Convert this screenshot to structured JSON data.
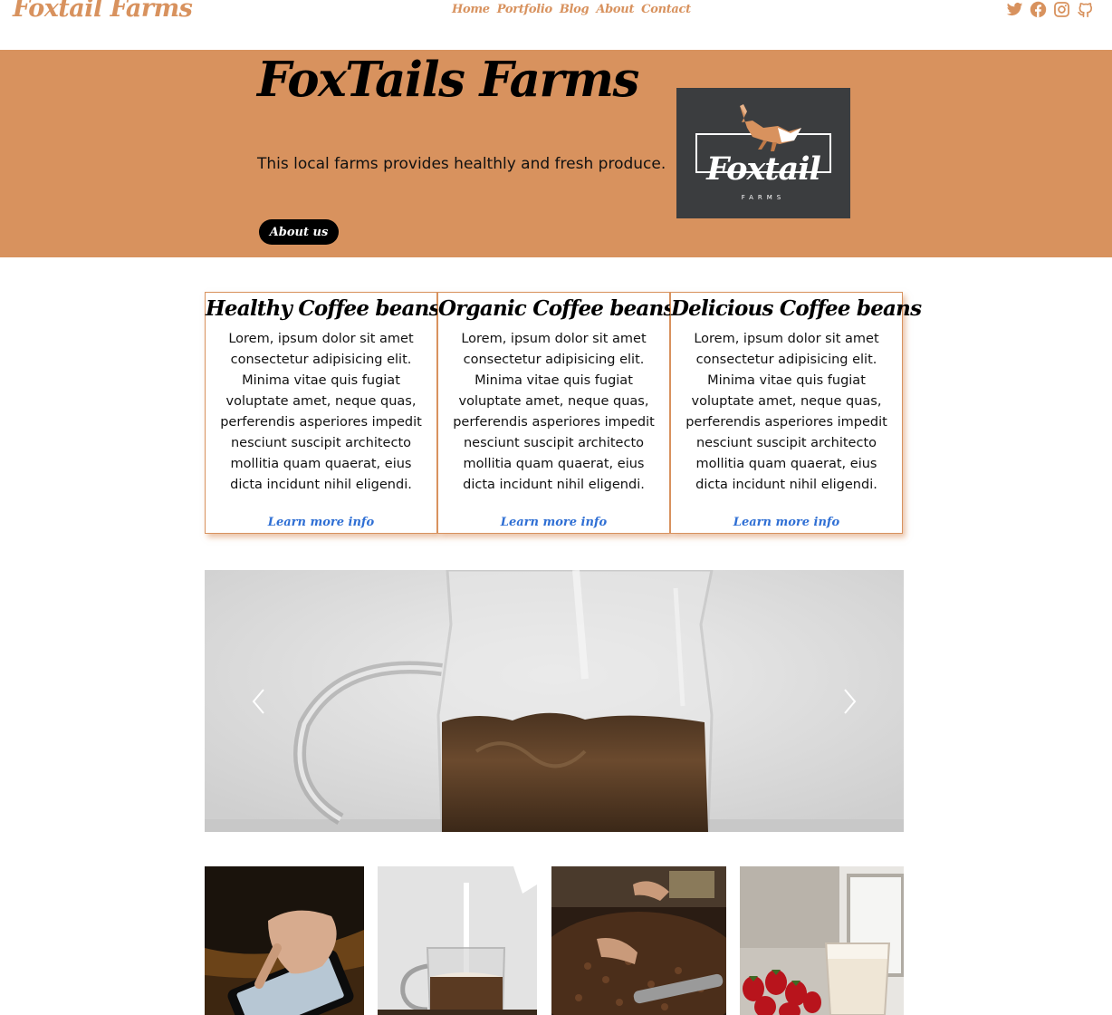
{
  "nav": {
    "brand": "Foxtail Farms",
    "links": [
      "Home",
      "Portfolio",
      "Blog",
      "About",
      "Contact"
    ],
    "social_icons": [
      "twitter-icon",
      "facebook-icon",
      "instagram-icon",
      "github-icon"
    ]
  },
  "hero": {
    "title": "FoxTails Farms",
    "tagline": "This local farms provides healthly and fresh produce.",
    "button_label": "About us",
    "logo": {
      "word": "Foxtail",
      "sub": "FARMS"
    }
  },
  "cards": [
    {
      "title": "Healthy Coffee beans",
      "body": "Lorem, ipsum dolor sit amet consectetur adipisicing elit. Minima vitae quis fugiat voluptate amet, neque quas, perferendis asperiores impedit nesciunt suscipit architecto mollitia quam quaerat, eius dicta incidunt nihil eligendi.",
      "link": "Learn more info"
    },
    {
      "title": "Organic Coffee beans",
      "body": "Lorem, ipsum dolor sit amet consectetur adipisicing elit. Minima vitae quis fugiat voluptate amet, neque quas, perferendis asperiores impedit nesciunt suscipit architecto mollitia quam quaerat, eius dicta incidunt nihil eligendi.",
      "link": "Learn more info"
    },
    {
      "title": "Delicious Coffee beans",
      "body": "Lorem, ipsum dolor sit amet consectetur adipisicing elit. Minima vitae quis fugiat voluptate amet, neque quas, perferendis asperiores impedit nesciunt suscipit architecto mollitia quam quaerat, eius dicta incidunt nihil eligendi.",
      "link": "Learn more info"
    }
  ],
  "carousel": {
    "prev_icon": "chevron-left-icon",
    "next_icon": "chevron-right-icon"
  },
  "colors": {
    "accent": "#d8925e",
    "link": "#2f6fd4",
    "logo_bg": "#3b3d3f"
  }
}
